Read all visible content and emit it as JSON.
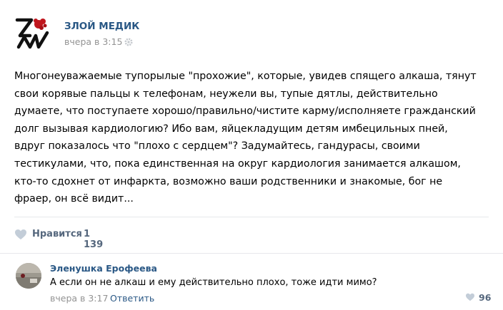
{
  "post": {
    "author": "ЗЛОЙ МЕДИК",
    "time": "вчера в 3:15",
    "text_lines": [
      "Многонеуважаемые тупорылые \"прохожие\", которые, увидев спящего алкаша, тянут",
      "свои корявые пальцы к телефонам, неужели вы, тупые дятлы, действительно",
      "думаете, что поступаете хорошо/правильно/чистите карму/исполняете гражданский",
      "долг вызывая кардиологию? Ибо вам, яйцекладущим детям имбецильных пней,",
      "вдруг показалось что \"плохо с сердцем\"? Задумайтесь, гандурасы, своими",
      "тестикулами, что,  пока единственная на округ кардиология занимается алкашом,",
      "кто-то сдохнет от инфаркта, возможно ваши родственники и знакомые, бог не",
      "фраер, он всё видит..."
    ],
    "like_label": "Нравится",
    "like_count": "1 139"
  },
  "comment": {
    "author": "Эленушка Ерофеева",
    "text": "А если он не алкаш и ему действительно плохо, тоже идти мимо?",
    "time": "вчера в 3:17",
    "reply_label": "Ответить",
    "like_count": "96"
  },
  "icons": {
    "logo": "zm-logo-icon",
    "settings": "gear-icon",
    "like": "heart-icon"
  },
  "colors": {
    "link": "#2a5885",
    "meta": "#939393",
    "like": "#55677d",
    "divider": "#e7e8ec"
  }
}
